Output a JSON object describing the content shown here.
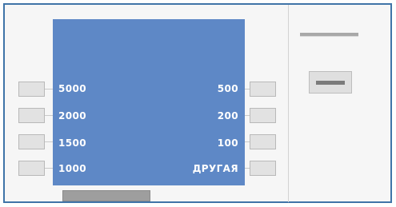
{
  "atm": {
    "left_amounts": [
      "5000",
      "2000",
      "1500",
      "1000"
    ],
    "right_amounts": [
      "500",
      "200",
      "100",
      "ДРУГАЯ"
    ]
  },
  "colors": {
    "screen": "#5e88c6",
    "frame_border": "#3f74a8",
    "key": "#e2e2e2"
  }
}
